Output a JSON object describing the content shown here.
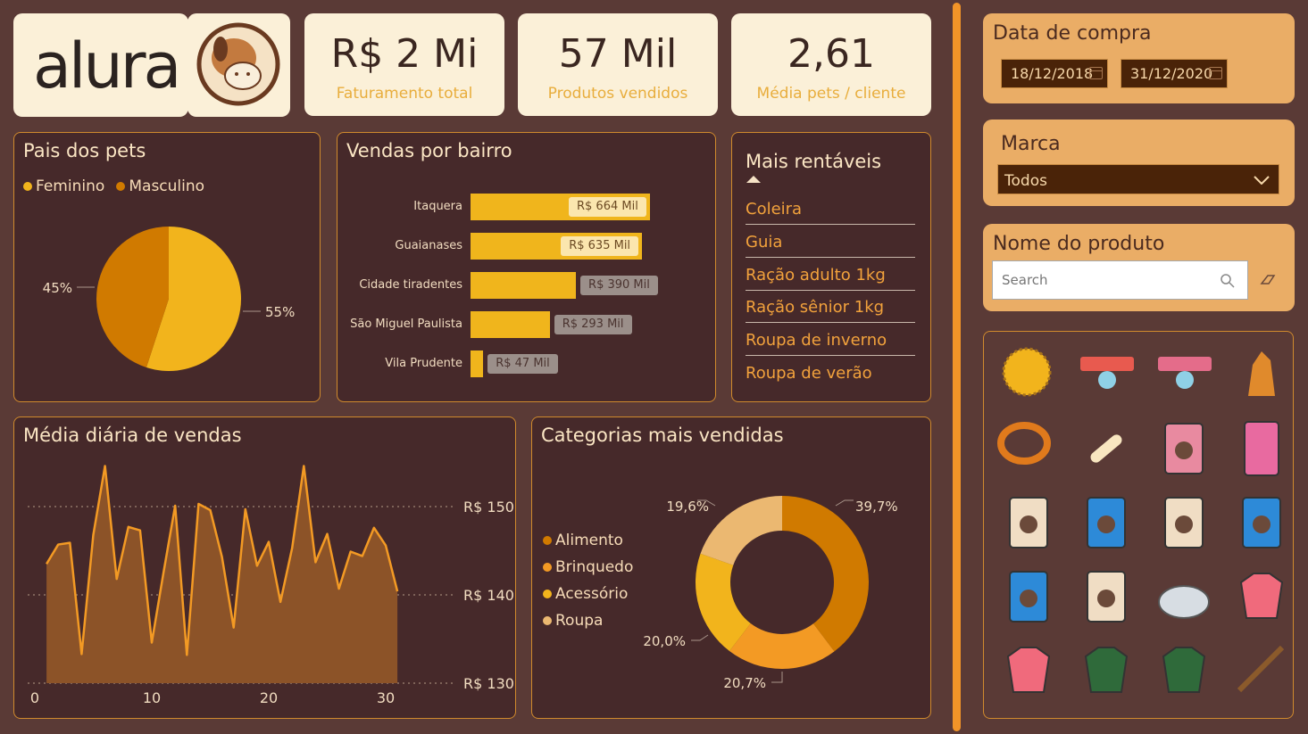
{
  "brand": {
    "logo_text": "alura"
  },
  "kpis": [
    {
      "value": "R$ 2 Mi",
      "label": "Faturamento total"
    },
    {
      "value": "57 Mil",
      "label": "Produtos vendidos"
    },
    {
      "value": "2,61",
      "label": "Média pets / cliente"
    }
  ],
  "pais_pets": {
    "title": "Pais dos pets",
    "legend": [
      {
        "label": "Feminino",
        "color": "#f2b41c"
      },
      {
        "label": "Masculino",
        "color": "#d07a00"
      }
    ],
    "chart_data": {
      "type": "pie",
      "slices": [
        {
          "label": "Feminino",
          "value": 55,
          "display": "55%"
        },
        {
          "label": "Masculino",
          "value": 45,
          "display": "45%"
        }
      ]
    }
  },
  "vendas_bairro": {
    "title": "Vendas por bairro",
    "chart_data": {
      "type": "bar",
      "categories": [
        "Itaquera",
        "Guaianases",
        "Cidade tiradentes",
        "São Miguel Paulista",
        "Vila Prudente"
      ],
      "values": [
        664,
        635,
        390,
        293,
        47
      ],
      "value_labels": [
        "R$ 664 Mil",
        "R$ 635 Mil",
        "R$ 390 Mil",
        "R$ 293 Mil",
        "R$ 47 Mil"
      ],
      "unit": "R$ Mil"
    }
  },
  "mais_rentaveis": {
    "title": "Mais rentáveis",
    "items": [
      "Coleira",
      "Guia",
      "Ração adulto 1kg",
      "Ração sênior 1kg",
      "Roupa de inverno",
      "Roupa de verão"
    ]
  },
  "media_diaria": {
    "title": "Média diária de vendas",
    "chart_data": {
      "type": "area",
      "x": [
        1,
        2,
        3,
        4,
        5,
        6,
        7,
        8,
        9,
        10,
        11,
        12,
        13,
        14,
        15,
        16,
        17,
        18,
        19,
        20,
        21,
        22,
        23,
        24,
        25,
        26,
        27,
        28,
        29,
        30,
        31
      ],
      "y": [
        143.5,
        145.7,
        145.9,
        133.3,
        146.8,
        154.6,
        141.8,
        147.7,
        147.3,
        134.6,
        142.5,
        150.1,
        133.2,
        150.3,
        149.6,
        144.3,
        136.3,
        149.7,
        143.3,
        146.0,
        139.2,
        145.3,
        154.6,
        143.7,
        146.9,
        140.7,
        144.9,
        144.4,
        147.6,
        145.6,
        140.4
      ],
      "x_ticks": [
        "0",
        "10",
        "20",
        "30"
      ],
      "y_ticks": [
        "R$ 150",
        "R$ 140",
        "R$ 130"
      ],
      "ylim": [
        130,
        160
      ]
    }
  },
  "categorias": {
    "title": "Categorias mais vendidas",
    "legend": [
      {
        "label": "Alimento",
        "color": "#d07a00"
      },
      {
        "label": "Brinquedo",
        "color": "#f39a24"
      },
      {
        "label": "Acessório",
        "color": "#f2b41c"
      },
      {
        "label": "Roupa",
        "color": "#ebb871"
      }
    ],
    "chart_data": {
      "type": "pie",
      "donut": true,
      "slices": [
        {
          "label": "Alimento",
          "value": 39.7,
          "display": "39,7%"
        },
        {
          "label": "Brinquedo",
          "value": 20.7,
          "display": "20,7%"
        },
        {
          "label": "Acessório",
          "value": 20.0,
          "display": "20,0%"
        },
        {
          "label": "Roupa",
          "value": 19.6,
          "display": "19,6%"
        }
      ]
    }
  },
  "filters": {
    "data_compra": {
      "title": "Data de compra",
      "start": "18/12/2018",
      "end": "31/12/2020"
    },
    "marca": {
      "title": "Marca",
      "value": "Todos"
    },
    "produto": {
      "title": "Nome do produto",
      "placeholder": "Search"
    }
  },
  "products": [
    "ball-icon",
    "collar-red-icon",
    "collar-pink-icon",
    "dog-toy-icon",
    "collar-leash-icon",
    "bone-icon",
    "treat-bag-icon",
    "cat-food-can-icon",
    "food-bag-icon",
    "dog-food-bag-icon",
    "food-bag-icon",
    "dog-food-bag-icon",
    "cat-food-bag-icon",
    "food-bag-icon",
    "mouse-toy-icon",
    "pink-coat-icon",
    "pink-coat-icon",
    "green-coat-icon",
    "green-coat-icon",
    "leash-icon"
  ]
}
